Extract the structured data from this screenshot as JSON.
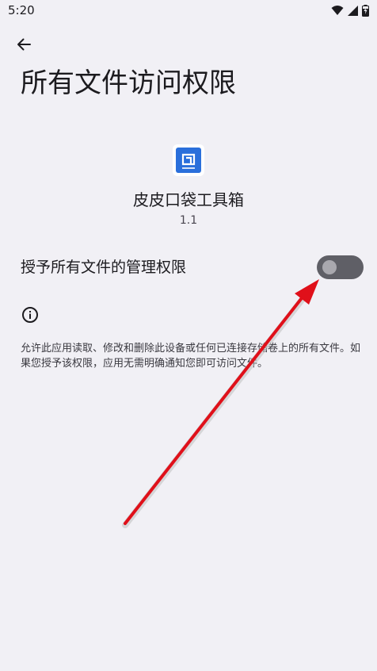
{
  "status_bar": {
    "time": "5:20",
    "icons": [
      "wifi-icon",
      "signal-icon",
      "battery-charging-icon"
    ]
  },
  "header": {
    "back_icon": "arrow-back-icon",
    "title": "所有文件访问权限"
  },
  "app": {
    "icon": "app-logo-icon",
    "name": "皮皮口袋工具箱",
    "version": "1.1"
  },
  "permission": {
    "label": "授予所有文件的管理权限",
    "enabled": false
  },
  "info": {
    "icon": "info-icon",
    "description": "允许此应用读取、修改和删除此设备或任何已连接存储卷上的所有文件。如果您授予该权限，应用无需明确通知您即可访问文件。"
  },
  "colors": {
    "background": "#f1f0f5",
    "toggle_track": "#5f5f66",
    "toggle_thumb": "#a9a8ae",
    "annotation_arrow": "#e0101a",
    "app_logo": "#2a6fdb"
  }
}
